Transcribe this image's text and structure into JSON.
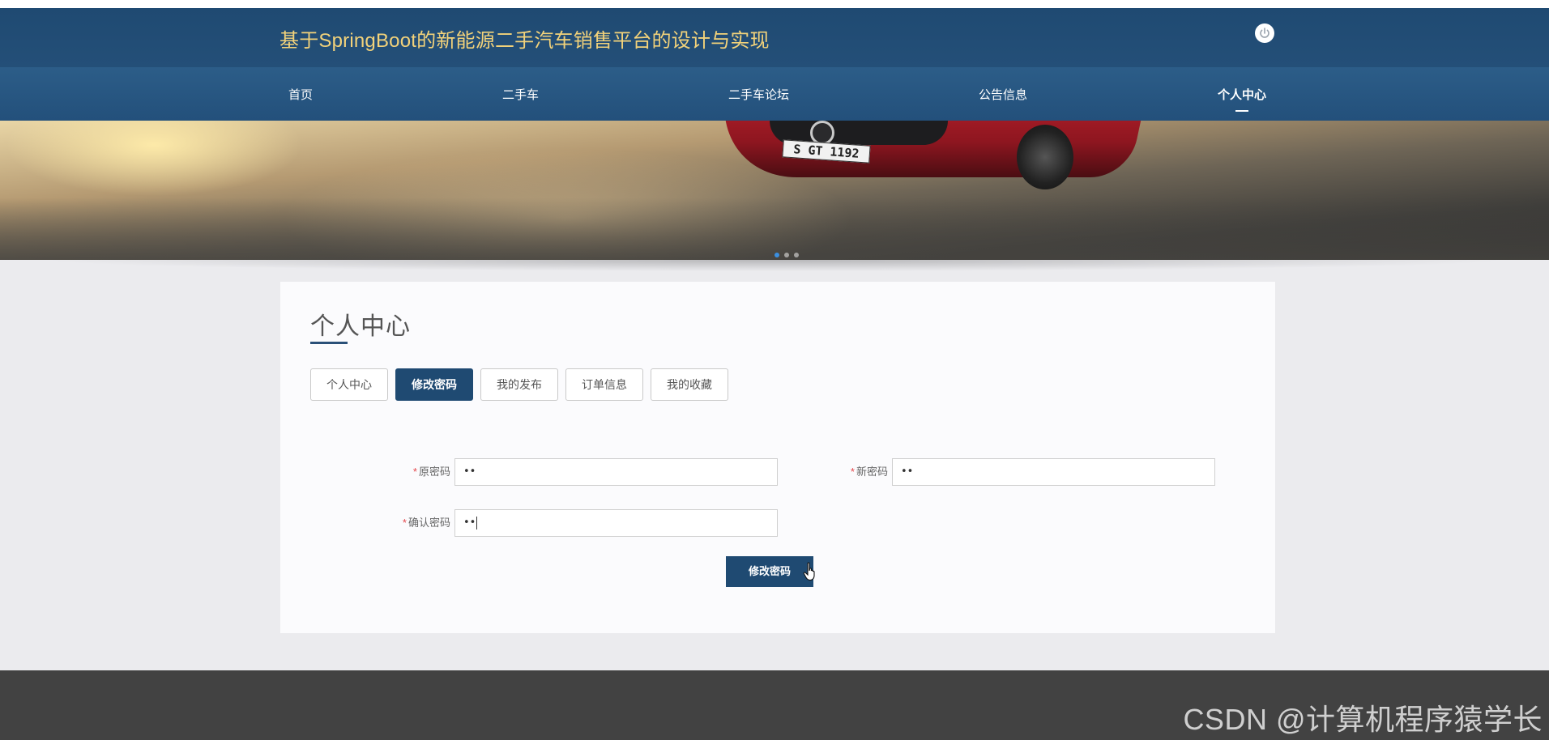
{
  "header": {
    "site_title": "基于SpringBoot的新能源二手汽车销售平台的设计与实现",
    "logout_icon": "power-icon"
  },
  "nav": {
    "items": [
      {
        "label": "首页",
        "active": false
      },
      {
        "label": "二手车",
        "active": false
      },
      {
        "label": "二手车论坛",
        "active": false
      },
      {
        "label": "公告信息",
        "active": false
      },
      {
        "label": "个人中心",
        "active": true
      }
    ]
  },
  "banner": {
    "plate_text": "S GT 1192",
    "slide_count": 3,
    "active_slide": 1
  },
  "panel": {
    "title": "个人中心",
    "tabs": [
      {
        "label": "个人中心",
        "active": false
      },
      {
        "label": "修改密码",
        "active": true
      },
      {
        "label": "我的发布",
        "active": false
      },
      {
        "label": "订单信息",
        "active": false
      },
      {
        "label": "我的收藏",
        "active": false
      }
    ]
  },
  "form": {
    "required_mark": "*",
    "old_password": {
      "label": "原密码",
      "value": "••"
    },
    "new_password": {
      "label": "新密码",
      "value": "••"
    },
    "confirm_password": {
      "label": "确认密码",
      "value": "••"
    },
    "submit_label": "修改密码"
  },
  "footer": {
    "watermark": "CSDN @计算机程序猿学长"
  },
  "colors": {
    "header_bg": "#1f4a72",
    "title_text": "#f2d27a",
    "accent": "#1f4a72",
    "required": "#e5484d",
    "footer_bg": "#424242"
  }
}
